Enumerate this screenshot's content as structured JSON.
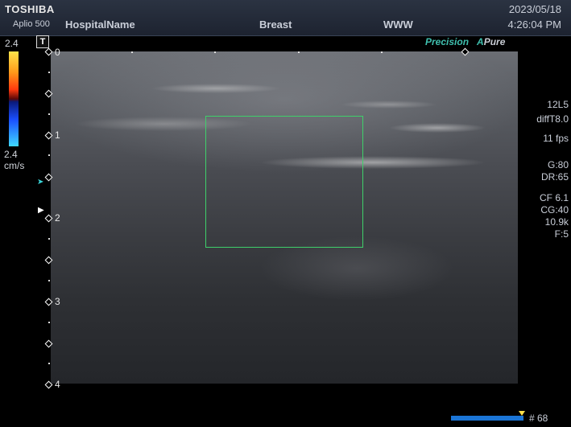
{
  "header": {
    "brand": "TOSHIBA",
    "model": "Aplio 500",
    "hospital": "HospitalName",
    "preset": "Breast",
    "www": "WWW",
    "date": "2023/05/18",
    "time": "4:26:04 PM"
  },
  "modes": {
    "precision": "Precision",
    "apure_a": "A",
    "apure_rest": "Pure"
  },
  "color_scale": {
    "top": "2.4",
    "bottom": "2.4",
    "unit": "cm/s"
  },
  "depth_marker": "T",
  "depth_labels": [
    "0",
    "1",
    "2",
    "3",
    "4"
  ],
  "params": {
    "probe": "12L5",
    "diff": "diffT8.0",
    "fps": "11 fps",
    "gain": "G:80",
    "dr": "DR:65",
    "cf": "CF 6.1",
    "cg": "CG:40",
    "prf": "10.9k",
    "filter": "F:5"
  },
  "frame": {
    "label": "# 68"
  }
}
